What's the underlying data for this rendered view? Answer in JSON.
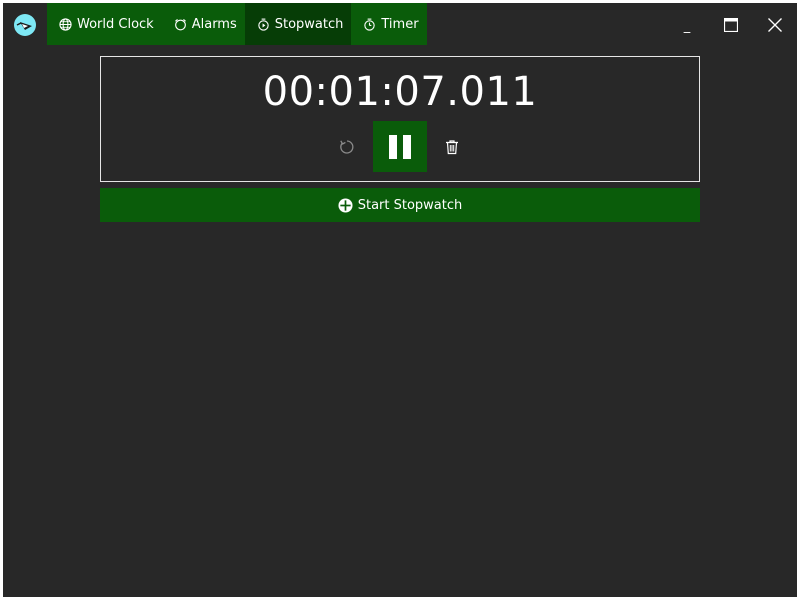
{
  "app": {
    "logo_icon": "clock-bird-logo-icon"
  },
  "tabs": [
    {
      "label": "World Clock",
      "icon": "globe-icon",
      "active": false
    },
    {
      "label": "Alarms",
      "icon": "alarm-clock-icon",
      "active": false
    },
    {
      "label": "Stopwatch",
      "icon": "stopwatch-icon",
      "active": true
    },
    {
      "label": "Timer",
      "icon": "timer-icon",
      "active": false
    }
  ],
  "window_controls": {
    "minimize_label": "_",
    "maximize_icon": "maximize-icon",
    "close_icon": "close-icon"
  },
  "stopwatch": {
    "time": "00:01:07.011",
    "reset_icon": "reset-icon",
    "pause_icon": "pause-icon",
    "delete_icon": "trash-icon",
    "start_label": "Start Stopwatch",
    "start_icon": "plus-circle-icon"
  },
  "colors": {
    "background": "#282828",
    "accent": "#0a5c0a",
    "accent_active": "#063d06",
    "text": "#ffffff",
    "logo": "#7ee8f5"
  }
}
